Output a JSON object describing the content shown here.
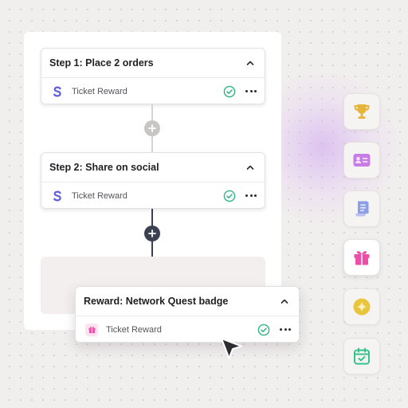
{
  "flow": {
    "steps": [
      {
        "title": "Step 1: Place 2 orders",
        "reward_label": "Ticket Reward"
      },
      {
        "title": "Step 2: Share on social",
        "reward_label": "Ticket Reward"
      }
    ],
    "reward": {
      "title": "Reward: Network Quest badge",
      "reward_label": "Ticket Reward"
    }
  },
  "side_toolbar": {
    "items": [
      {
        "name": "trophy-icon",
        "color": "#e7b43a"
      },
      {
        "name": "id-card-icon",
        "color": "#c77ce8"
      },
      {
        "name": "scroll-icon",
        "color": "#8c9ee8"
      },
      {
        "name": "gift-icon",
        "color": "#ec4fa5"
      },
      {
        "name": "star-badge-icon",
        "color": "#e8c53c"
      },
      {
        "name": "calendar-check-icon",
        "color": "#36c28c"
      }
    ]
  },
  "colors": {
    "accent_check": "#2db57e",
    "s_logo": "#5d5fdc",
    "add_active": "#3b4150",
    "add_inactive": "#c9c5c5"
  }
}
